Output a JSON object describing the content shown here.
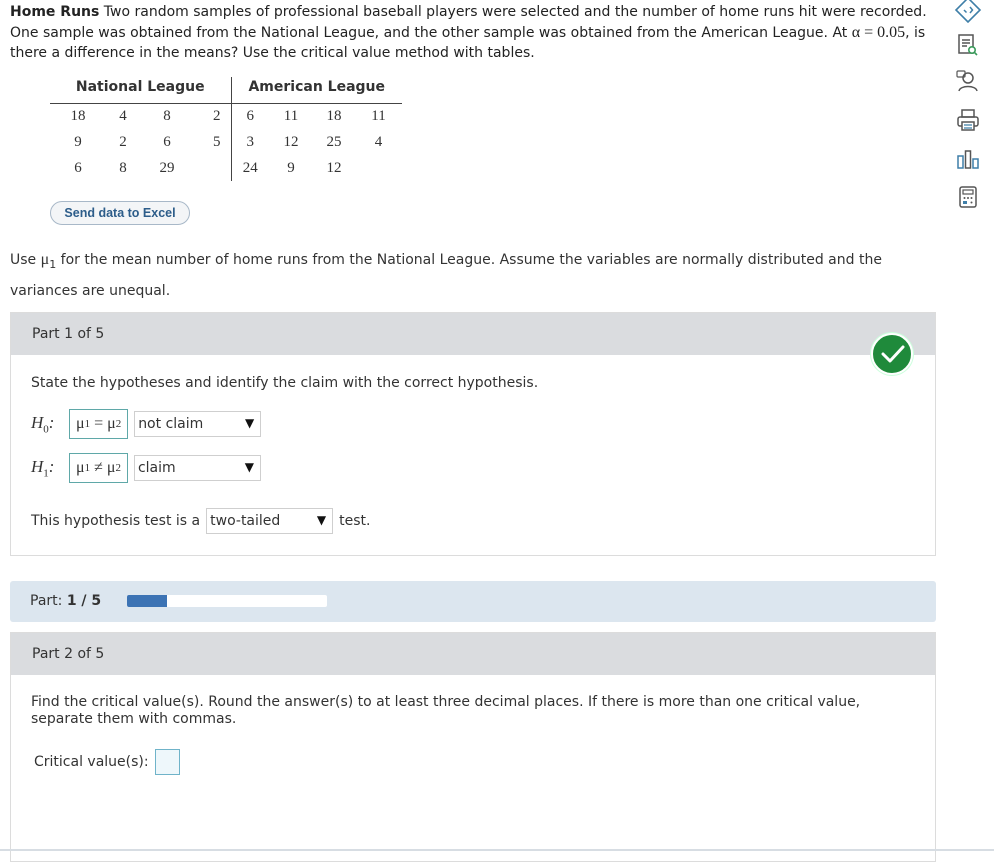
{
  "problem": {
    "title": "Home Runs",
    "text_1": "Two random samples of professional baseball players were selected and the number of home runs hit were recorded. One sample was obtained from the National League, and the other sample was obtained from the American League. At",
    "alpha": "α = 0.05",
    "text_2": ", is there a difference in the means? Use the critical value method with tables."
  },
  "table": {
    "headers": [
      "National League",
      "American League"
    ],
    "national_rows": [
      [
        "18",
        "4",
        "8",
        "2"
      ],
      [
        "9",
        "2",
        "6",
        "5"
      ],
      [
        "6",
        "8",
        "29",
        ""
      ]
    ],
    "american_rows": [
      [
        "6",
        "11",
        "18",
        "11"
      ],
      [
        "3",
        "12",
        "25",
        "4"
      ],
      [
        "24",
        "9",
        "12",
        ""
      ]
    ]
  },
  "excel_button": "Send data to Excel",
  "instructions": {
    "before": "Use",
    "mu": "μ",
    "sub": "1",
    "after": "for the mean number of home runs from the National League. Assume the variables are normally distributed and the variances are unequal."
  },
  "part1": {
    "header": "Part 1 of 5",
    "prompt": "State the hypotheses and identify the claim with the correct hypothesis.",
    "h0": {
      "label": "H",
      "sub": "0",
      "mu": "μ",
      "s1": "1",
      "op": " = ",
      "s2": "2",
      "claim": "not claim"
    },
    "h1": {
      "label": "H",
      "sub": "1",
      "mu": "μ",
      "s1": "1",
      "op": " ≠ ",
      "s2": "2",
      "claim": "claim"
    },
    "test_before": "This hypothesis test is a",
    "test_value": "two-tailed",
    "test_after": "test."
  },
  "progress": {
    "label": "Part:",
    "value": "1 / 5",
    "fraction": 0.2
  },
  "part2": {
    "header": "Part 2 of 5",
    "prompt": "Find the critical value(s). Round the answer(s) to at least three decimal places. If there is more than one critical value, separate them with commas.",
    "label": "Critical value(s):",
    "value": ""
  },
  "sidebar_icons": [
    "nav-diamond-icon",
    "reference-doc-icon",
    "tutor-icon",
    "print-icon",
    "chart-icon",
    "calculator-icon"
  ]
}
